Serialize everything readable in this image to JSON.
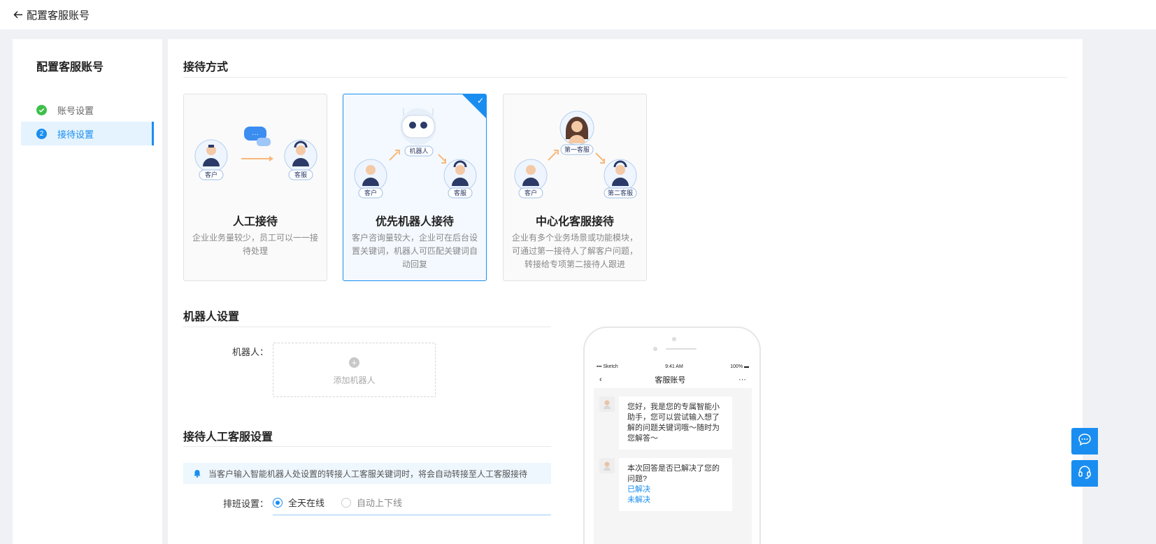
{
  "topbar": {
    "title": "配置客服账号"
  },
  "sidebar": {
    "title": "配置客服账号",
    "steps": [
      {
        "label": "账号设置",
        "status": "done"
      },
      {
        "label": "接待设置",
        "num": "2",
        "status": "active"
      }
    ]
  },
  "reception": {
    "title": "接待方式",
    "cards": [
      {
        "title": "人工接待",
        "desc": "企业业务量较少，员工可以一一接待处理",
        "labels": [
          "客户",
          "客服"
        ]
      },
      {
        "title": "优先机器人接待",
        "desc": "客户咨询量较大，企业可在后台设置关键词，机器人可匹配关键词自动回复",
        "labels": [
          "机器人",
          "客户",
          "客服"
        ],
        "selected": true
      },
      {
        "title": "中心化客服接待",
        "desc": "企业有多个业务场景或功能模块，可通过第一接待人了解客户问题，转接给专项第二接待人跟进",
        "labels": [
          "第一客服",
          "客户",
          "第二客服"
        ]
      }
    ]
  },
  "robot": {
    "title": "机器人设置",
    "label": "机器人：",
    "add_text": "添加机器人"
  },
  "human": {
    "title": "接待人工客服设置",
    "notice": "当客户输入智能机器人处设置的转接人工客服关键词时，将会自动转接至人工客服接待",
    "schedule_label": "排班设置：",
    "options": [
      "全天在线",
      "自动上下线"
    ],
    "selected_option": "全天在线"
  },
  "phone": {
    "carrier": "Sketch",
    "time": "9:41 AM",
    "battery": "100%",
    "nav_title": "客服账号",
    "messages": [
      {
        "text": "您好，我是您的专属智能小助手，您可以尝试输入想了解的问题关键词哦～随时为您解答～"
      },
      {
        "text": "本次回答是否已解决了您的问题?",
        "links": [
          "已解决",
          "未解决"
        ]
      }
    ]
  },
  "colors": {
    "accent": "#1a8ef0",
    "success": "#3ec04a"
  },
  "icons": [
    "back-arrow-icon",
    "check-circle-icon",
    "plus-icon",
    "bell-icon",
    "chat-icon",
    "headset-icon"
  ]
}
